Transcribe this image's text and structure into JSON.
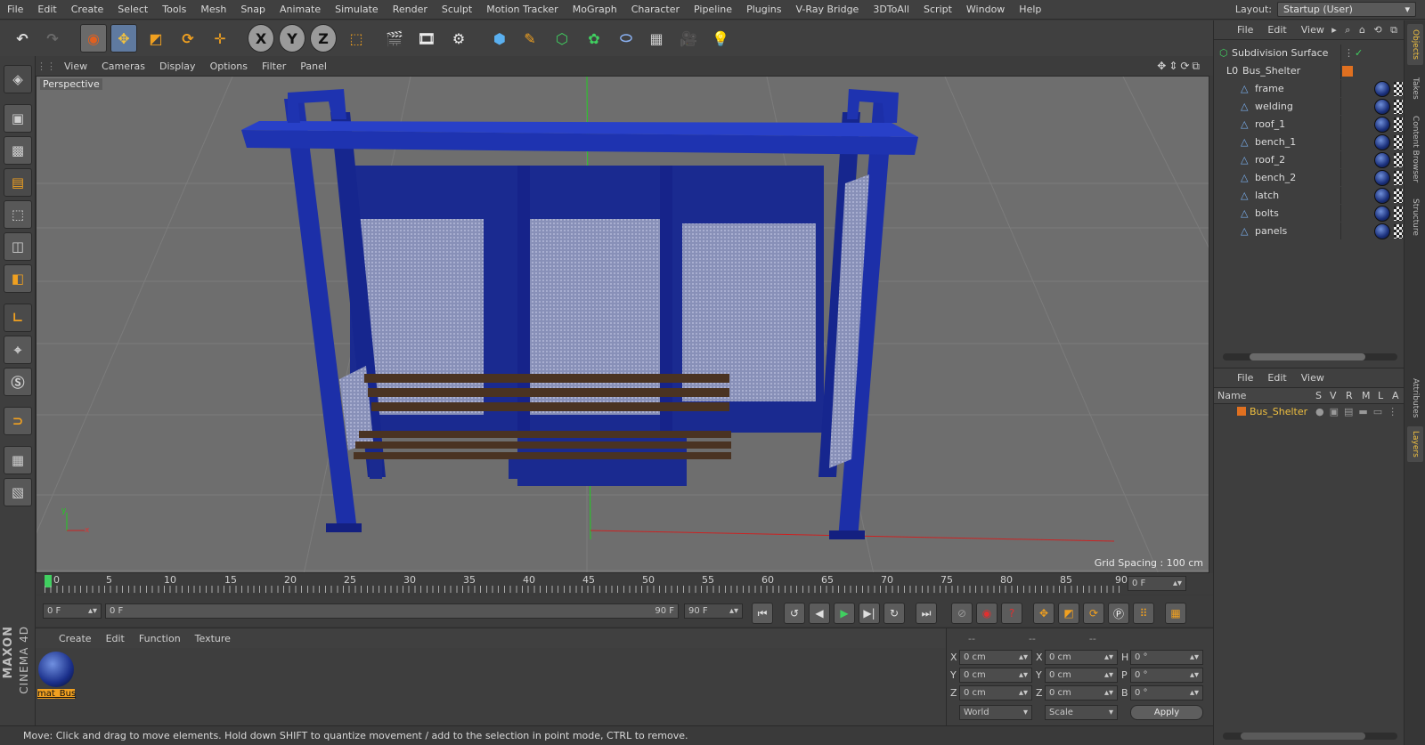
{
  "menubar": {
    "items": [
      "File",
      "Edit",
      "Create",
      "Select",
      "Tools",
      "Mesh",
      "Snap",
      "Animate",
      "Simulate",
      "Render",
      "Sculpt",
      "Motion Tracker",
      "MoGraph",
      "Character",
      "Pipeline",
      "Plugins",
      "V-Ray Bridge",
      "3DToAll",
      "Script",
      "Window",
      "Help"
    ],
    "layout_label": "Layout:",
    "layout_value": "Startup (User)"
  },
  "toolbar": {
    "x": "X",
    "y": "Y",
    "z": "Z"
  },
  "viewport": {
    "menu": [
      "View",
      "Cameras",
      "Display",
      "Options",
      "Filter",
      "Panel"
    ],
    "label": "Perspective",
    "grid_spacing": "Grid Spacing : 100 cm",
    "axis_x": "x",
    "axis_y": "y"
  },
  "timeline": {
    "ticks": [
      "0",
      "5",
      "10",
      "15",
      "20",
      "25",
      "30",
      "35",
      "40",
      "45",
      "50",
      "55",
      "60",
      "65",
      "70",
      "75",
      "80",
      "85",
      "90"
    ],
    "current": "0 F"
  },
  "playbar": {
    "start": "0 F",
    "slider_left": "0 F",
    "slider_right": "90 F",
    "end": "90 F"
  },
  "material_manager": {
    "menu": [
      "Create",
      "Edit",
      "Function",
      "Texture"
    ],
    "materials": [
      {
        "name": "mat_Bus"
      }
    ]
  },
  "coordinates": {
    "header": [
      "--",
      "--",
      "--"
    ],
    "rows": [
      {
        "a": "X",
        "av": "0 cm",
        "b": "X",
        "bv": "0 cm",
        "c": "H",
        "cv": "0 °"
      },
      {
        "a": "Y",
        "av": "0 cm",
        "b": "Y",
        "bv": "0 cm",
        "c": "P",
        "cv": "0 °"
      },
      {
        "a": "Z",
        "av": "0 cm",
        "b": "Z",
        "bv": "0 cm",
        "c": "B",
        "cv": "0 °"
      }
    ],
    "mode1": "World",
    "mode2": "Scale",
    "apply": "Apply"
  },
  "status": "Move: Click and drag to move elements. Hold down SHIFT to quantize movement / add to the selection in point mode, CTRL to remove.",
  "object_manager": {
    "menu": [
      "File",
      "Edit",
      "View"
    ],
    "objects": [
      {
        "name": "Subdivision Surface",
        "indent": 0
      },
      {
        "name": "Bus_Shelter",
        "indent": 1
      },
      {
        "name": "frame",
        "indent": 2
      },
      {
        "name": "welding",
        "indent": 2
      },
      {
        "name": "roof_1",
        "indent": 2
      },
      {
        "name": "bench_1",
        "indent": 2
      },
      {
        "name": "roof_2",
        "indent": 2
      },
      {
        "name": "bench_2",
        "indent": 2
      },
      {
        "name": "latch",
        "indent": 2
      },
      {
        "name": "bolts",
        "indent": 2
      },
      {
        "name": "panels",
        "indent": 2
      }
    ]
  },
  "layer_manager": {
    "menu": [
      "File",
      "Edit",
      "View"
    ],
    "columns": [
      "Name",
      "S",
      "V",
      "R",
      "M",
      "L",
      "A"
    ],
    "layers": [
      {
        "name": "Bus_Shelter"
      }
    ]
  },
  "side_tabs": [
    "Objects",
    "Takes",
    "Content Browser",
    "Structure",
    "Attributes",
    "Layers"
  ],
  "brand": {
    "maxon": "MAXON",
    "product": "CINEMA 4D"
  },
  "colors": {
    "shelter_blue": "#1a2fa0",
    "bench_brown": "#4a3322",
    "layer_orange": "#e07020",
    "accent_yellow": "#f0c040"
  }
}
